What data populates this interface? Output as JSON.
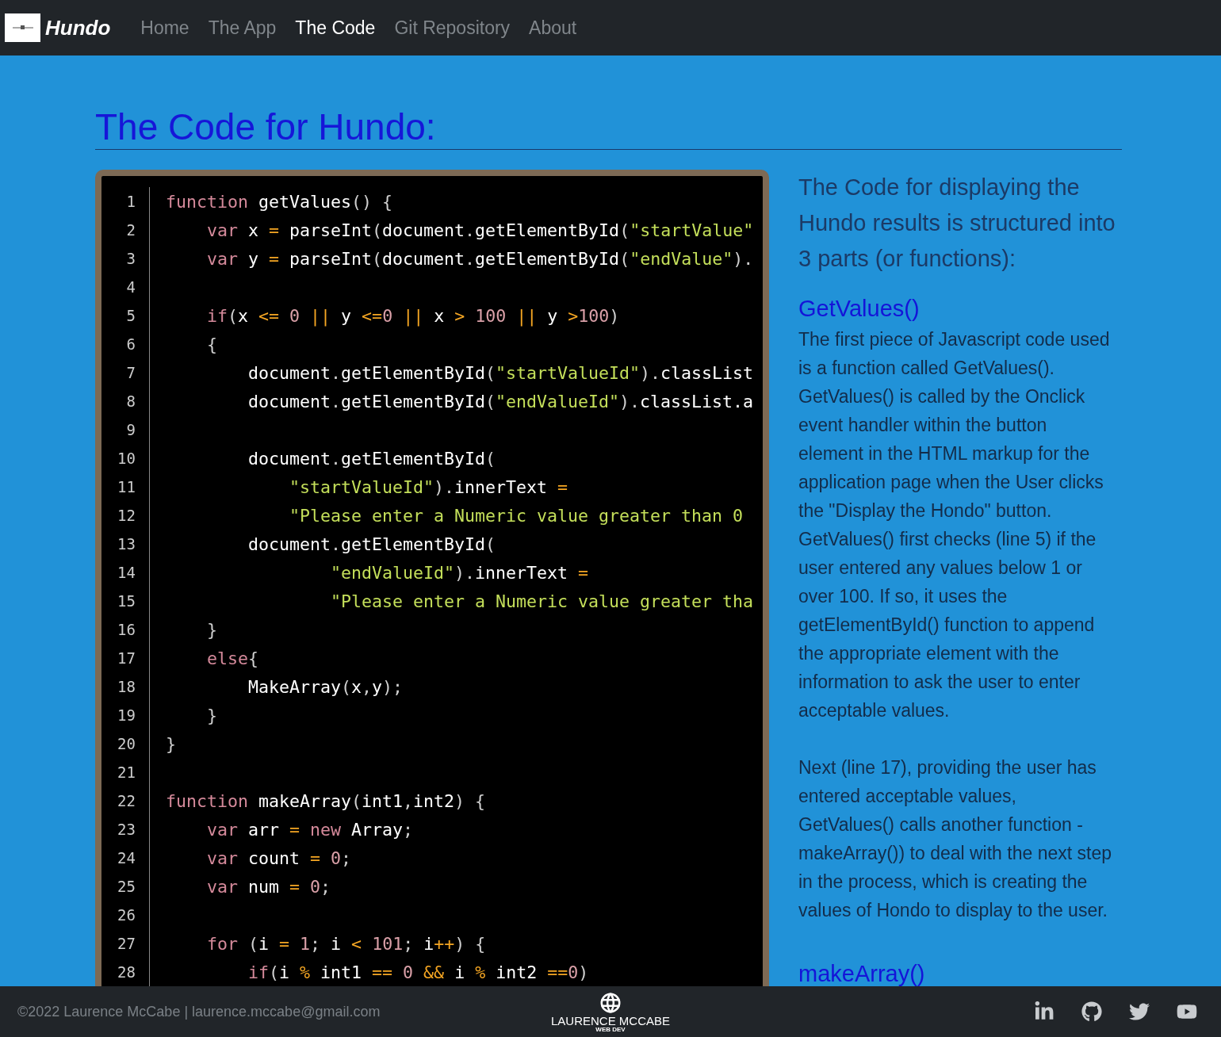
{
  "nav": {
    "brand": "Hundo",
    "links": [
      {
        "label": "Home",
        "selected": false
      },
      {
        "label": "The App",
        "selected": false
      },
      {
        "label": "The Code",
        "selected": true
      },
      {
        "label": "Git Repository",
        "selected": false
      },
      {
        "label": "About",
        "selected": false
      }
    ]
  },
  "title": "The Code for Hundo:",
  "code": {
    "lines": [
      {
        "n": "1",
        "t": [
          {
            "kind": "kw",
            "t": "function"
          },
          {
            "kind": "id",
            "t": " getValues"
          },
          {
            "kind": "p",
            "t": "() {"
          }
        ]
      },
      {
        "n": "2",
        "t": [
          {
            "kind": "kw",
            "t": "    var"
          },
          {
            "kind": "id",
            "t": " x "
          },
          {
            "kind": "op",
            "t": "="
          },
          {
            "kind": "id",
            "t": " parseInt"
          },
          {
            "kind": "p",
            "t": "("
          },
          {
            "kind": "id",
            "t": "document"
          },
          {
            "kind": "p",
            "t": "."
          },
          {
            "kind": "id",
            "t": "getElementById"
          },
          {
            "kind": "p",
            "t": "("
          },
          {
            "kind": "str",
            "t": "\"startValue\""
          }
        ]
      },
      {
        "n": "3",
        "t": [
          {
            "kind": "kw",
            "t": "    var"
          },
          {
            "kind": "id",
            "t": " y "
          },
          {
            "kind": "op",
            "t": "="
          },
          {
            "kind": "id",
            "t": " parseInt"
          },
          {
            "kind": "p",
            "t": "("
          },
          {
            "kind": "id",
            "t": "document"
          },
          {
            "kind": "p",
            "t": "."
          },
          {
            "kind": "id",
            "t": "getElementById"
          },
          {
            "kind": "p",
            "t": "("
          },
          {
            "kind": "str",
            "t": "\"endValue\""
          },
          {
            "kind": "p",
            "t": ")."
          }
        ]
      },
      {
        "n": "4"
      },
      {
        "n": "5",
        "t": [
          {
            "kind": "kw",
            "t": "    if"
          },
          {
            "kind": "p",
            "t": "("
          },
          {
            "kind": "id",
            "t": "x "
          },
          {
            "kind": "op",
            "t": "<="
          },
          {
            "kind": "num",
            "t": " 0 "
          },
          {
            "kind": "op",
            "t": "||"
          },
          {
            "kind": "id",
            "t": " y "
          },
          {
            "kind": "op",
            "t": "<="
          },
          {
            "kind": "num",
            "t": "0 "
          },
          {
            "kind": "op",
            "t": "||"
          },
          {
            "kind": "id",
            "t": " x "
          },
          {
            "kind": "op",
            "t": ">"
          },
          {
            "kind": "num",
            "t": " 100 "
          },
          {
            "kind": "op",
            "t": "||"
          },
          {
            "kind": "id",
            "t": " y "
          },
          {
            "kind": "op",
            "t": ">"
          },
          {
            "kind": "num",
            "t": "100"
          },
          {
            "kind": "p",
            "t": ")"
          }
        ]
      },
      {
        "n": "6",
        "t": [
          {
            "kind": "p",
            "t": "    {"
          }
        ]
      },
      {
        "n": "7",
        "t": [
          {
            "kind": "id",
            "t": "        document"
          },
          {
            "kind": "p",
            "t": "."
          },
          {
            "kind": "id",
            "t": "getElementById"
          },
          {
            "kind": "p",
            "t": "("
          },
          {
            "kind": "str",
            "t": "\"startValueId\""
          },
          {
            "kind": "p",
            "t": ")."
          },
          {
            "kind": "id",
            "t": "classList"
          }
        ]
      },
      {
        "n": "8",
        "t": [
          {
            "kind": "id",
            "t": "        document"
          },
          {
            "kind": "p",
            "t": "."
          },
          {
            "kind": "id",
            "t": "getElementById"
          },
          {
            "kind": "p",
            "t": "("
          },
          {
            "kind": "str",
            "t": "\"endValueId\""
          },
          {
            "kind": "p",
            "t": ")."
          },
          {
            "kind": "id",
            "t": "classList.a"
          }
        ]
      },
      {
        "n": "9"
      },
      {
        "n": "10",
        "t": [
          {
            "kind": "id",
            "t": "        document"
          },
          {
            "kind": "p",
            "t": "."
          },
          {
            "kind": "id",
            "t": "getElementById"
          },
          {
            "kind": "p",
            "t": "("
          }
        ]
      },
      {
        "n": "11",
        "t": [
          {
            "kind": "str",
            "t": "            \"startValueId\""
          },
          {
            "kind": "p",
            "t": ")."
          },
          {
            "kind": "id",
            "t": "innerText "
          },
          {
            "kind": "op",
            "t": "="
          }
        ]
      },
      {
        "n": "12",
        "t": [
          {
            "kind": "str",
            "t": "            \"Please enter a Numeric value greater than 0"
          }
        ]
      },
      {
        "n": "13",
        "t": [
          {
            "kind": "id",
            "t": "        document"
          },
          {
            "kind": "p",
            "t": "."
          },
          {
            "kind": "id",
            "t": "getElementById"
          },
          {
            "kind": "p",
            "t": "("
          }
        ]
      },
      {
        "n": "14",
        "t": [
          {
            "kind": "str",
            "t": "                \"endValueId\""
          },
          {
            "kind": "p",
            "t": ")."
          },
          {
            "kind": "id",
            "t": "innerText "
          },
          {
            "kind": "op",
            "t": "="
          }
        ]
      },
      {
        "n": "15",
        "t": [
          {
            "kind": "str",
            "t": "                \"Please enter a Numeric value greater tha"
          }
        ]
      },
      {
        "n": "16",
        "t": [
          {
            "kind": "p",
            "t": "    }"
          }
        ]
      },
      {
        "n": "17",
        "t": [
          {
            "kind": "kw",
            "t": "    else"
          },
          {
            "kind": "p",
            "t": "{"
          }
        ]
      },
      {
        "n": "18",
        "t": [
          {
            "kind": "id",
            "t": "        MakeArray"
          },
          {
            "kind": "p",
            "t": "("
          },
          {
            "kind": "id",
            "t": "x"
          },
          {
            "kind": "p",
            "t": ","
          },
          {
            "kind": "id",
            "t": "y"
          },
          {
            "kind": "p",
            "t": ");"
          }
        ]
      },
      {
        "n": "19",
        "t": [
          {
            "kind": "p",
            "t": "    }"
          }
        ]
      },
      {
        "n": "20",
        "t": [
          {
            "kind": "p",
            "t": "}"
          }
        ]
      },
      {
        "n": "21"
      },
      {
        "n": "22",
        "t": [
          {
            "kind": "kw",
            "t": "function"
          },
          {
            "kind": "id",
            "t": " makeArray"
          },
          {
            "kind": "p",
            "t": "("
          },
          {
            "kind": "id",
            "t": "int1"
          },
          {
            "kind": "p",
            "t": ","
          },
          {
            "kind": "id",
            "t": "int2"
          },
          {
            "kind": "p",
            "t": ") {"
          }
        ]
      },
      {
        "n": "23",
        "t": [
          {
            "kind": "kw",
            "t": "    var"
          },
          {
            "kind": "id",
            "t": " arr "
          },
          {
            "kind": "op",
            "t": "="
          },
          {
            "kind": "kw",
            "t": " new"
          },
          {
            "kind": "id",
            "t": " Array"
          },
          {
            "kind": "p",
            "t": ";"
          }
        ]
      },
      {
        "n": "24",
        "t": [
          {
            "kind": "kw",
            "t": "    var"
          },
          {
            "kind": "id",
            "t": " count "
          },
          {
            "kind": "op",
            "t": "="
          },
          {
            "kind": "num",
            "t": " 0"
          },
          {
            "kind": "p",
            "t": ";"
          }
        ]
      },
      {
        "n": "25",
        "t": [
          {
            "kind": "kw",
            "t": "    var"
          },
          {
            "kind": "id",
            "t": " num "
          },
          {
            "kind": "op",
            "t": "="
          },
          {
            "kind": "num",
            "t": " 0"
          },
          {
            "kind": "p",
            "t": ";"
          }
        ]
      },
      {
        "n": "26"
      },
      {
        "n": "27",
        "t": [
          {
            "kind": "kw",
            "t": "    for"
          },
          {
            "kind": "p",
            "t": " ("
          },
          {
            "kind": "id",
            "t": "i "
          },
          {
            "kind": "op",
            "t": "="
          },
          {
            "kind": "num",
            "t": " 1"
          },
          {
            "kind": "p",
            "t": ";"
          },
          {
            "kind": "id",
            "t": " i "
          },
          {
            "kind": "op",
            "t": "<"
          },
          {
            "kind": "num",
            "t": " 101"
          },
          {
            "kind": "p",
            "t": ";"
          },
          {
            "kind": "id",
            "t": " i"
          },
          {
            "kind": "op",
            "t": "++"
          },
          {
            "kind": "p",
            "t": ") {"
          }
        ]
      },
      {
        "n": "28",
        "t": [
          {
            "kind": "kw",
            "t": "        if"
          },
          {
            "kind": "p",
            "t": "("
          },
          {
            "kind": "id",
            "t": "i "
          },
          {
            "kind": "op",
            "t": "%"
          },
          {
            "kind": "id",
            "t": " int1 "
          },
          {
            "kind": "op",
            "t": "=="
          },
          {
            "kind": "num",
            "t": " 0 "
          },
          {
            "kind": "op",
            "t": "&&"
          },
          {
            "kind": "id",
            "t": " i "
          },
          {
            "kind": "op",
            "t": "%"
          },
          {
            "kind": "id",
            "t": " int2 "
          },
          {
            "kind": "op",
            "t": "=="
          },
          {
            "kind": "num",
            "t": "0"
          },
          {
            "kind": "p",
            "t": ")"
          }
        ]
      }
    ]
  },
  "aside": [
    {
      "kind": "intro",
      "text": "The Code for displaying the Hundo results is structured into 3 parts (or functions):"
    },
    {
      "kind": "heading",
      "text": "GetValues()"
    },
    {
      "kind": "para",
      "text": "The first piece of Javascript code used is a function called GetValues(). GetValues() is called by the Onclick event handler within the button element in the HTML markup for the application page when the User clicks the \"Display the Hondo\" button. GetValues() first checks (line 5) if the user entered any values below 1 or over 100. If so, it uses the getElementById() function to append the appropriate element with the information to ask the user to enter acceptable values."
    },
    {
      "kind": "para",
      "text": "Next (line 17), providing the user has entered acceptable values, GetValues() calls another function - makeArray()) to deal with the next step in the process, which is creating the values of Hondo to display to the user."
    },
    {
      "kind": "heading",
      "text": "makeArray()"
    }
  ],
  "footer": {
    "copyright": "©2022 Laurence McCabe | laurence.mccabe@gmail.com",
    "logo_name": "LAURENCE MCCABE",
    "logo_sub": "WEB DEV"
  }
}
